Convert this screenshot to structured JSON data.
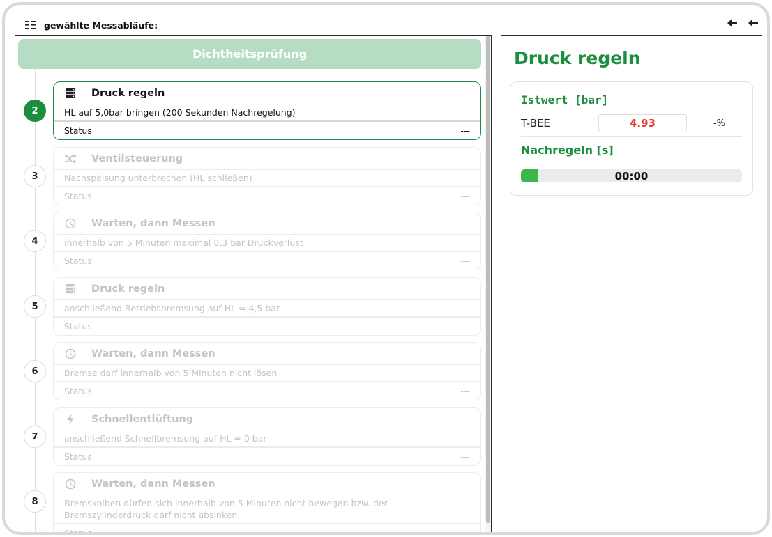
{
  "header": {
    "icon": "list-icon",
    "title": "gewählte Messabläufe:",
    "actions": [
      "arrow-left-icon",
      "arrow-left-icon"
    ]
  },
  "banner": {
    "label": "Dichtheitsprüfung"
  },
  "steps": [
    {
      "number": "2",
      "icon": "server-icon",
      "title": "Druck regeln",
      "description": "HL auf 5,0bar bringen (200 Sekunden Nachregelung)",
      "status_label": "Status",
      "status_value": "---",
      "active": true
    },
    {
      "number": "3",
      "icon": "shuffle-icon",
      "title": "Ventilsteuerung",
      "description": "Nachspeisung unterbrechen (HL schließen)",
      "status_label": "Status",
      "status_value": "---",
      "active": false
    },
    {
      "number": "4",
      "icon": "clock-icon",
      "title": "Warten, dann Messen",
      "description": "innerhalb von 5 Minuten maximal 0,3 bar Druckverlust",
      "status_label": "Status",
      "status_value": "---",
      "active": false
    },
    {
      "number": "5",
      "icon": "server-icon",
      "title": "Druck regeln",
      "description": "anschließend Betriebsbremsung auf HL = 4,5 bar",
      "status_label": "Status",
      "status_value": "---",
      "active": false
    },
    {
      "number": "6",
      "icon": "clock-icon",
      "title": "Warten, dann Messen",
      "description": "Bremse darf innerhalb von 5 Minuten nicht lösen",
      "status_label": "Status",
      "status_value": "---",
      "active": false
    },
    {
      "number": "7",
      "icon": "bolt-icon",
      "title": "Schnellentlüftung",
      "description": "anschließend Schnellbremsung auf HL = 0 bar",
      "status_label": "Status",
      "status_value": "---",
      "active": false
    },
    {
      "number": "8",
      "icon": "clock-icon",
      "title": "Warten, dann Messen",
      "description": "Bremskolben dürfen sich innerhalb von 5 Minuten nicht bewegen bzw. der Bremszylinderdruck darf nicht absinken.",
      "status_label": "Status",
      "status_value": "---",
      "active": false
    }
  ],
  "detail": {
    "title": "Druck regeln",
    "istwert_title": "Istwert [bar]",
    "sensor_label": "T-BEE",
    "sensor_value": "4.93",
    "sensor_unit": "-%",
    "nachregeln_title": "Nachregeln [s]",
    "timer_text": "00:00",
    "timer_progress": 0.08
  },
  "colors": {
    "accent_green": "#1b8f3f",
    "banner_green": "#b6ddc4",
    "value_red": "#e53935",
    "progress_green": "#3cb54a"
  }
}
